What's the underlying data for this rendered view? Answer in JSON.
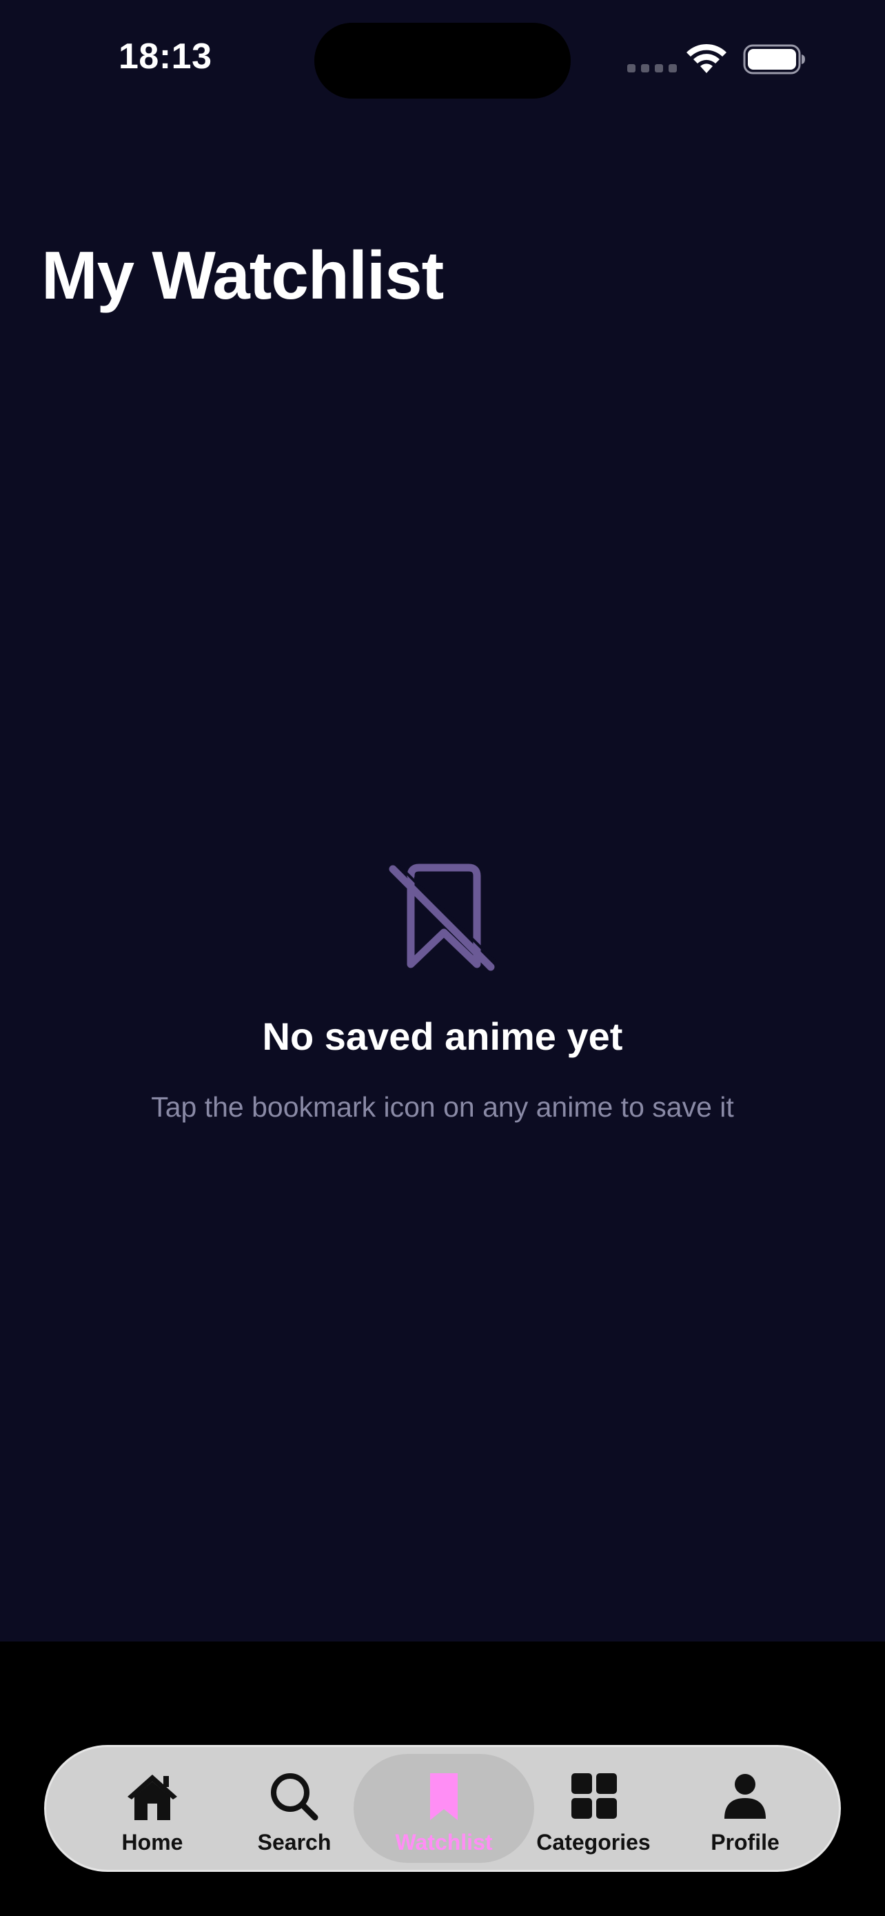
{
  "status_bar": {
    "time": "18:13"
  },
  "page": {
    "title": "My Watchlist"
  },
  "empty_state": {
    "icon": "bookmark-slash-icon",
    "title": "No saved anime yet",
    "subtitle": "Tap the bookmark icon on any anime to save it"
  },
  "tab_bar": {
    "active_index": 2,
    "tabs": [
      {
        "label": "Home",
        "icon": "home-icon"
      },
      {
        "label": "Search",
        "icon": "search-icon"
      },
      {
        "label": "Watchlist",
        "icon": "bookmark-icon"
      },
      {
        "label": "Categories",
        "icon": "grid-icon"
      },
      {
        "label": "Profile",
        "icon": "person-icon"
      }
    ]
  },
  "colors": {
    "background": "#0c0c22",
    "accent": "#ff8ef5",
    "empty_icon": "#6b5a96",
    "subtitle": "#8a8aa6",
    "tab_bar": "#d0d0d0"
  }
}
